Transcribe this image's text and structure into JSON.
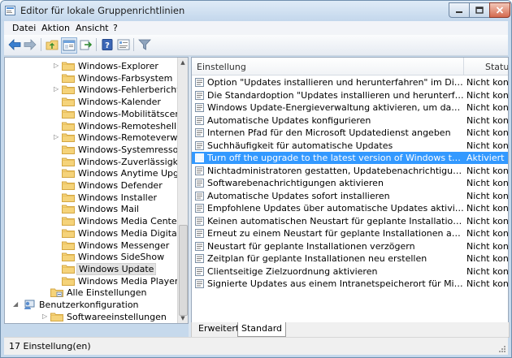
{
  "window": {
    "title": "Editor für lokale Gruppenrichtlinien"
  },
  "menu": [
    "Datei",
    "Aktion",
    "Ansicht",
    "?"
  ],
  "toolbar": {
    "icons": [
      "back-arrow-icon",
      "forward-arrow-icon",
      "up-folder-icon",
      "show-hide-tree-icon",
      "export-list-icon",
      "help-icon",
      "properties-icon",
      "filter-icon"
    ]
  },
  "tree": [
    {
      "label": "Windows-Explorer",
      "expander": true,
      "selected": false,
      "kind": "folder",
      "level": 2
    },
    {
      "label": "Windows-Farbsystem",
      "expander": false,
      "selected": false,
      "kind": "folder",
      "level": 2
    },
    {
      "label": "Windows-Fehlerberichterstattung",
      "expander": true,
      "selected": false,
      "kind": "folder",
      "level": 2
    },
    {
      "label": "Windows-Kalender",
      "expander": false,
      "selected": false,
      "kind": "folder",
      "level": 2
    },
    {
      "label": "Windows-Mobilitätscenter",
      "expander": false,
      "selected": false,
      "kind": "folder",
      "level": 2
    },
    {
      "label": "Windows-Remoteshell",
      "expander": false,
      "selected": false,
      "kind": "folder",
      "level": 2
    },
    {
      "label": "Windows-Remoteverwaltung",
      "expander": true,
      "selected": false,
      "kind": "folder",
      "level": 2
    },
    {
      "label": "Windows-Systemressourcen",
      "expander": false,
      "selected": false,
      "kind": "folder",
      "level": 2
    },
    {
      "label": "Windows-Zuverlässigkeitsanalyse",
      "expander": false,
      "selected": false,
      "kind": "folder",
      "level": 2
    },
    {
      "label": "Windows Anytime Upgrade",
      "expander": false,
      "selected": false,
      "kind": "folder",
      "level": 2
    },
    {
      "label": "Windows Defender",
      "expander": false,
      "selected": false,
      "kind": "folder",
      "level": 2
    },
    {
      "label": "Windows Installer",
      "expander": false,
      "selected": false,
      "kind": "folder",
      "level": 2
    },
    {
      "label": "Windows Mail",
      "expander": false,
      "selected": false,
      "kind": "folder",
      "level": 2
    },
    {
      "label": "Windows Media Center",
      "expander": false,
      "selected": false,
      "kind": "folder",
      "level": 2
    },
    {
      "label": "Windows Media Digital Rights Management",
      "expander": false,
      "selected": false,
      "kind": "folder",
      "level": 2
    },
    {
      "label": "Windows Messenger",
      "expander": false,
      "selected": false,
      "kind": "folder",
      "level": 2
    },
    {
      "label": "Windows SideShow",
      "expander": false,
      "selected": false,
      "kind": "folder",
      "level": 2
    },
    {
      "label": "Windows Update",
      "expander": false,
      "selected": true,
      "kind": "folder",
      "level": 2
    },
    {
      "label": "Windows Media Player",
      "expander": false,
      "selected": false,
      "kind": "folder",
      "level": 2
    },
    {
      "label": "Alle Einstellungen",
      "expander": false,
      "selected": false,
      "kind": "settings",
      "level": 1
    },
    {
      "label": "Benutzerkonfiguration",
      "expander": true,
      "selected": false,
      "kind": "user",
      "level": 0
    },
    {
      "label": "Softwareeinstellungen",
      "expander": true,
      "selected": false,
      "kind": "folder",
      "level": 1
    }
  ],
  "list": {
    "columns": [
      "Einstellung",
      "Status"
    ],
    "rows": [
      {
        "name": "Option \"Updates installieren und herunterfahren\" im Dialogfeld \"Windows herunterfahren\" nicht anzeigen",
        "status": "Nicht konfiguriert",
        "selected": false
      },
      {
        "name": "Die Standardoption \"Updates installieren und herunterfahren\" im Dialogfeld \"Windows herunterfahren\" nicht anpassen",
        "status": "Nicht konfiguriert",
        "selected": false
      },
      {
        "name": "Windows Update-Energieverwaltung aktivieren, um das System zur Installation von geplanten Updates zu reaktivieren",
        "status": "Nicht konfiguriert",
        "selected": false
      },
      {
        "name": "Automatische Updates konfigurieren",
        "status": "Nicht konfiguriert",
        "selected": false
      },
      {
        "name": "Internen Pfad für den Microsoft Updatedienst angeben",
        "status": "Nicht konfiguriert",
        "selected": false
      },
      {
        "name": "Suchhäufigkeit für automatische Updates",
        "status": "Nicht konfiguriert",
        "selected": false
      },
      {
        "name": "Turn off the upgrade to the latest version of Windows through Windows Update",
        "status": "Aktiviert",
        "selected": true
      },
      {
        "name": "Nichtadministratoren gestatten, Updatebenachrichtigungen zu erhalten",
        "status": "Nicht konfiguriert",
        "selected": false
      },
      {
        "name": "Softwarebenachrichtigungen aktivieren",
        "status": "Nicht konfiguriert",
        "selected": false
      },
      {
        "name": "Automatische Updates sofort installieren",
        "status": "Nicht konfiguriert",
        "selected": false
      },
      {
        "name": "Empfohlene Updates über automatische Updates aktivieren",
        "status": "Nicht konfiguriert",
        "selected": false
      },
      {
        "name": "Keinen automatischen Neustart für geplante Installationen automatischer Updates durchführen",
        "status": "Nicht konfiguriert",
        "selected": false
      },
      {
        "name": "Erneut zu einem Neustart für geplante Installationen auffordern",
        "status": "Nicht konfiguriert",
        "selected": false
      },
      {
        "name": "Neustart für geplante Installationen verzögern",
        "status": "Nicht konfiguriert",
        "selected": false
      },
      {
        "name": "Zeitplan für geplante Installationen neu erstellen",
        "status": "Nicht konfiguriert",
        "selected": false
      },
      {
        "name": "Clientseitige Zielzuordnung aktivieren",
        "status": "Nicht konfiguriert",
        "selected": false
      },
      {
        "name": "Signierte Updates aus einem Intranetspeicherort für Microsoft-Updatedienste zulassen",
        "status": "Nicht konfiguriert",
        "selected": false
      }
    ]
  },
  "tabs": [
    {
      "label": "Erweitert",
      "active": false
    },
    {
      "label": "Standard",
      "active": true
    }
  ],
  "status": {
    "text": "17 Einstellung(en)"
  },
  "colors": {
    "selection": "#3399ff",
    "folder": "#f5d37a",
    "folder_border": "#d3a642"
  }
}
